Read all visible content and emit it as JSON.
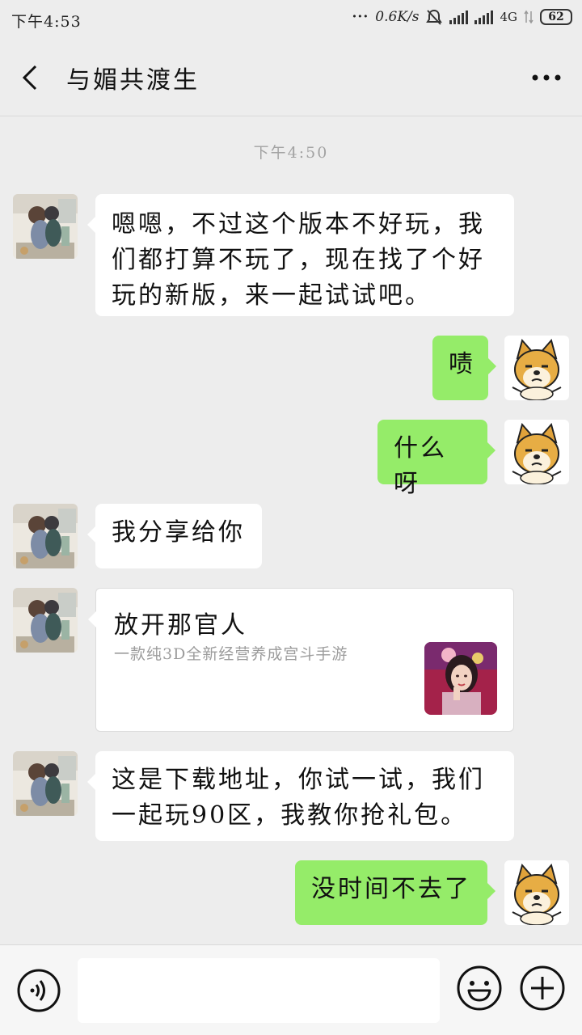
{
  "status_bar": {
    "time": "下午4:53",
    "net_speed": "0.6K/s",
    "network": "4G",
    "battery": "62"
  },
  "header": {
    "title": "与媚共渡生"
  },
  "chat": {
    "timestamp": "下午4:50",
    "messages": [
      {
        "side": "left",
        "text": "嗯嗯，不过这个版本不好玩，我们都打算不玩了，现在找了个好玩的新版，来一起试试吧。",
        "lines": [
          "嗯嗯，不过这个版本不好玩，我",
          "们都打算不玩了，现在找了个好",
          "玩的新版，来一起试试吧。"
        ]
      },
      {
        "side": "right",
        "text": "啧"
      },
      {
        "side": "right",
        "text": "什么呀"
      },
      {
        "side": "left",
        "text": "我分享给你"
      },
      {
        "side": "left",
        "type": "card",
        "title": "放开那官人",
        "desc": "一款纯3D全新经营养成宫斗手游"
      },
      {
        "side": "left",
        "text": "这是下载地址，你试一试，我们一起玩90区，我教你抢礼包。",
        "lines": [
          "这是下载地址，你试一试，我们",
          "一起玩90区，我教你抢礼包。"
        ]
      },
      {
        "side": "right",
        "text": "没时间不去了"
      }
    ]
  },
  "input_bar": {
    "placeholder": "",
    "icons": [
      "voice-icon",
      "emoji-icon",
      "plus-icon"
    ]
  },
  "colors": {
    "background": "#ededed",
    "bubble_self": "#95ec69",
    "bubble_other": "#ffffff"
  }
}
